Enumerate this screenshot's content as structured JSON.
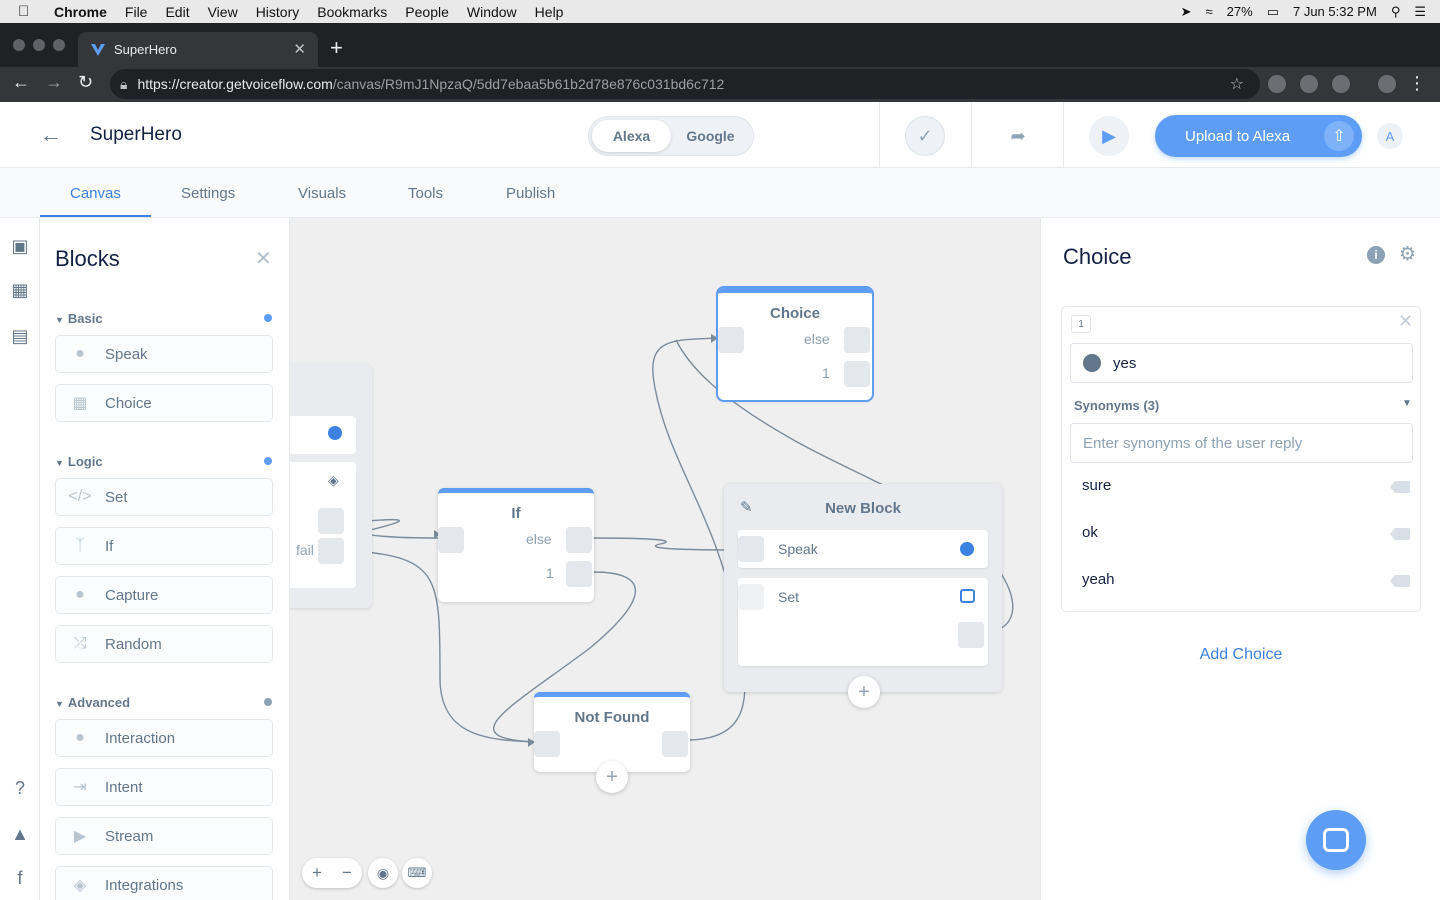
{
  "menubar": {
    "app": "Chrome",
    "items": [
      "File",
      "Edit",
      "View",
      "History",
      "Bookmarks",
      "People",
      "Window",
      "Help"
    ],
    "battery": "27%",
    "datetime": "7 Jun  5:32 PM"
  },
  "browser": {
    "tab_title": "SuperHero",
    "url_host": "https://creator.getvoiceflow.com",
    "url_path": "/canvas/R9mJ1NpzaQ/5dd7ebaa5b61b2d78e876c031bd6c712"
  },
  "header": {
    "project_title": "SuperHero",
    "platforms": [
      "Alexa",
      "Google"
    ],
    "upload_label": "Upload to Alexa",
    "avatar_initial": "A"
  },
  "tabs": [
    "Canvas",
    "Settings",
    "Visuals",
    "Tools",
    "Publish"
  ],
  "blocks_panel": {
    "title": "Blocks",
    "sections": [
      {
        "name": "Basic",
        "items": [
          {
            "label": "Speak",
            "icon": "speech-bubble-icon"
          },
          {
            "label": "Choice",
            "icon": "choice-icon"
          }
        ]
      },
      {
        "name": "Logic",
        "items": [
          {
            "label": "Set",
            "icon": "code-icon"
          },
          {
            "label": "If",
            "icon": "branch-icon"
          },
          {
            "label": "Capture",
            "icon": "microphone-icon"
          },
          {
            "label": "Random",
            "icon": "shuffle-icon"
          }
        ]
      },
      {
        "name": "Advanced",
        "items": [
          {
            "label": "Interaction",
            "icon": "user-icon"
          },
          {
            "label": "Intent",
            "icon": "arrow-bar-icon"
          },
          {
            "label": "Stream",
            "icon": "play-icon"
          },
          {
            "label": "Integrations",
            "icon": "globe-icon"
          }
        ]
      }
    ]
  },
  "canvas": {
    "partial_node_label": "fail",
    "choice_node": {
      "title": "Choice",
      "ports": [
        "else",
        "1"
      ]
    },
    "if_node": {
      "title": "If",
      "ports": [
        "else",
        "1"
      ]
    },
    "new_block": {
      "title": "New Block",
      "steps": [
        "Speak",
        "Set"
      ]
    },
    "not_found_node": {
      "title": "Not Found"
    }
  },
  "choice_panel": {
    "title": "Choice",
    "choice_number": "1",
    "intent": "yes",
    "synonyms_label": "Synonyms (3)",
    "synonyms_placeholder": "Enter synonyms of the user reply",
    "synonyms": [
      "sure",
      "ok",
      "yeah"
    ],
    "add_choice_label": "Add Choice"
  }
}
